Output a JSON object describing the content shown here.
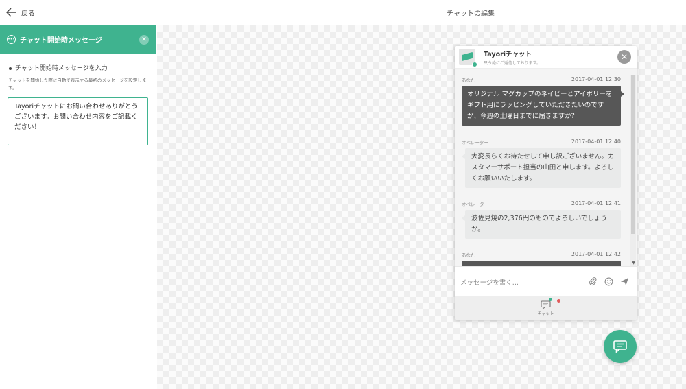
{
  "topbar": {
    "back_label": "戻る",
    "title": "チャットの編集"
  },
  "panel": {
    "title": "チャット開始時メッセージ",
    "section_label": "チャット開始時メッセージを入力",
    "helper": "チャットを開始した際に自動で表示する最初のメッセージを設定します。",
    "message_value": "Tayoriチャットにお問い合わせありがとうございます。お問い合わせ内容をご記載ください！"
  },
  "widget": {
    "name": "Tayoriチャット",
    "status": "只今絶にご返信しております。",
    "messages": [
      {
        "sender": "あなた",
        "time": "2017-04-01 12:30",
        "text": "オリジナル マグカップのネイビーとアイボリーをギフト用にラッピングしていただきたいのですが、今週の土曜日までに届きますか？"
      },
      {
        "sender": "オペレーター",
        "time": "2017-04-01 12:40",
        "text": "大変長らくお待たせして申し訳ございません。カスタマーサポート担当の山田と申します。よろしくお願いいたします。"
      },
      {
        "sender": "オペレーター",
        "time": "2017-04-01 12:41",
        "text": "波佐見焼の2,376円のものでよろしいでしょうか。"
      },
      {
        "sender": "あなた",
        "time": "2017-04-01 12:42"
      }
    ],
    "input_placeholder": "メッセージを書く...",
    "footer_tab": "チャット"
  },
  "colors": {
    "accent": "#3fb38f",
    "dark_bubble": "#575757",
    "op_bubble": "#e9eaea"
  }
}
